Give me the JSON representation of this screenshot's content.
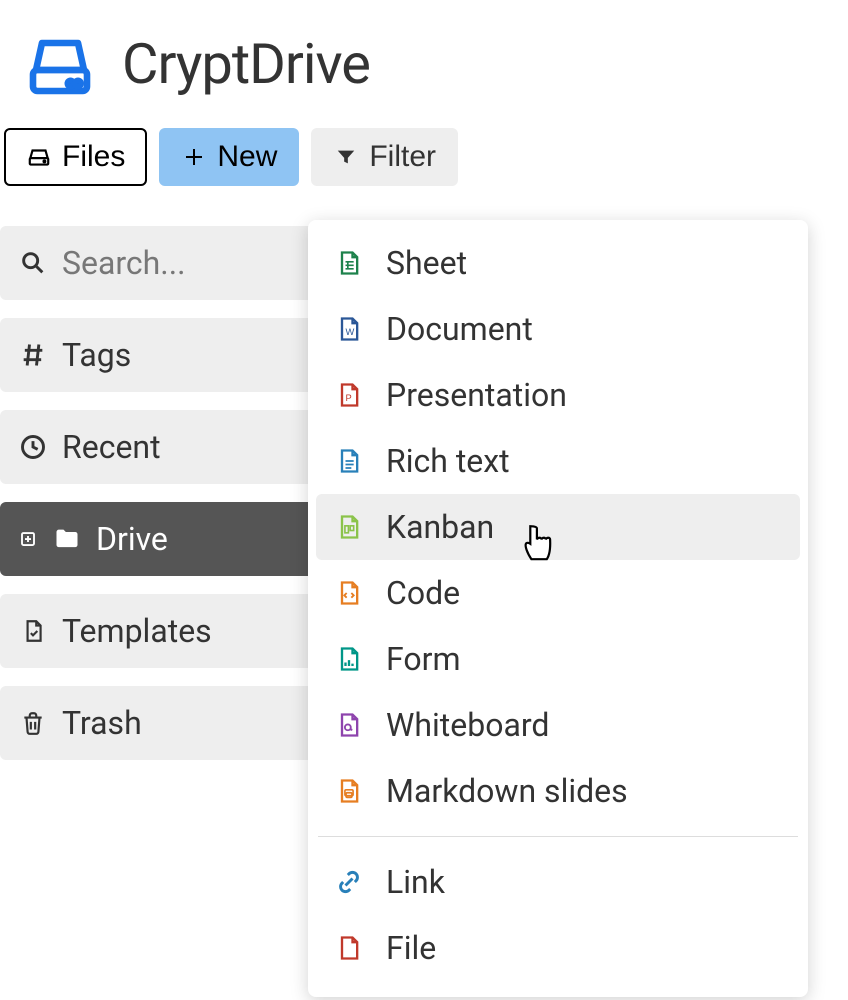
{
  "header": {
    "title": "CryptDrive"
  },
  "toolbar": {
    "files_label": "Files",
    "new_label": "New",
    "filter_label": "Filter"
  },
  "sidebar": {
    "search_placeholder": "Search...",
    "tags_label": "Tags",
    "recent_label": "Recent",
    "drive_label": "Drive",
    "templates_label": "Templates",
    "trash_label": "Trash"
  },
  "new_menu": {
    "items": [
      {
        "label": "Sheet",
        "color": "#1e824c"
      },
      {
        "label": "Document",
        "color": "#2b5797"
      },
      {
        "label": "Presentation",
        "color": "#c0392b"
      },
      {
        "label": "Rich text",
        "color": "#2980b9"
      },
      {
        "label": "Kanban",
        "color": "#8bc34a"
      },
      {
        "label": "Code",
        "color": "#e67e22"
      },
      {
        "label": "Form",
        "color": "#009688"
      },
      {
        "label": "Whiteboard",
        "color": "#8e44ad"
      },
      {
        "label": "Markdown slides",
        "color": "#e67e22"
      }
    ],
    "extra": [
      {
        "label": "Link",
        "color": "#2980b9"
      },
      {
        "label": "File",
        "color": "#c0392b"
      }
    ],
    "hover_index": 4
  }
}
